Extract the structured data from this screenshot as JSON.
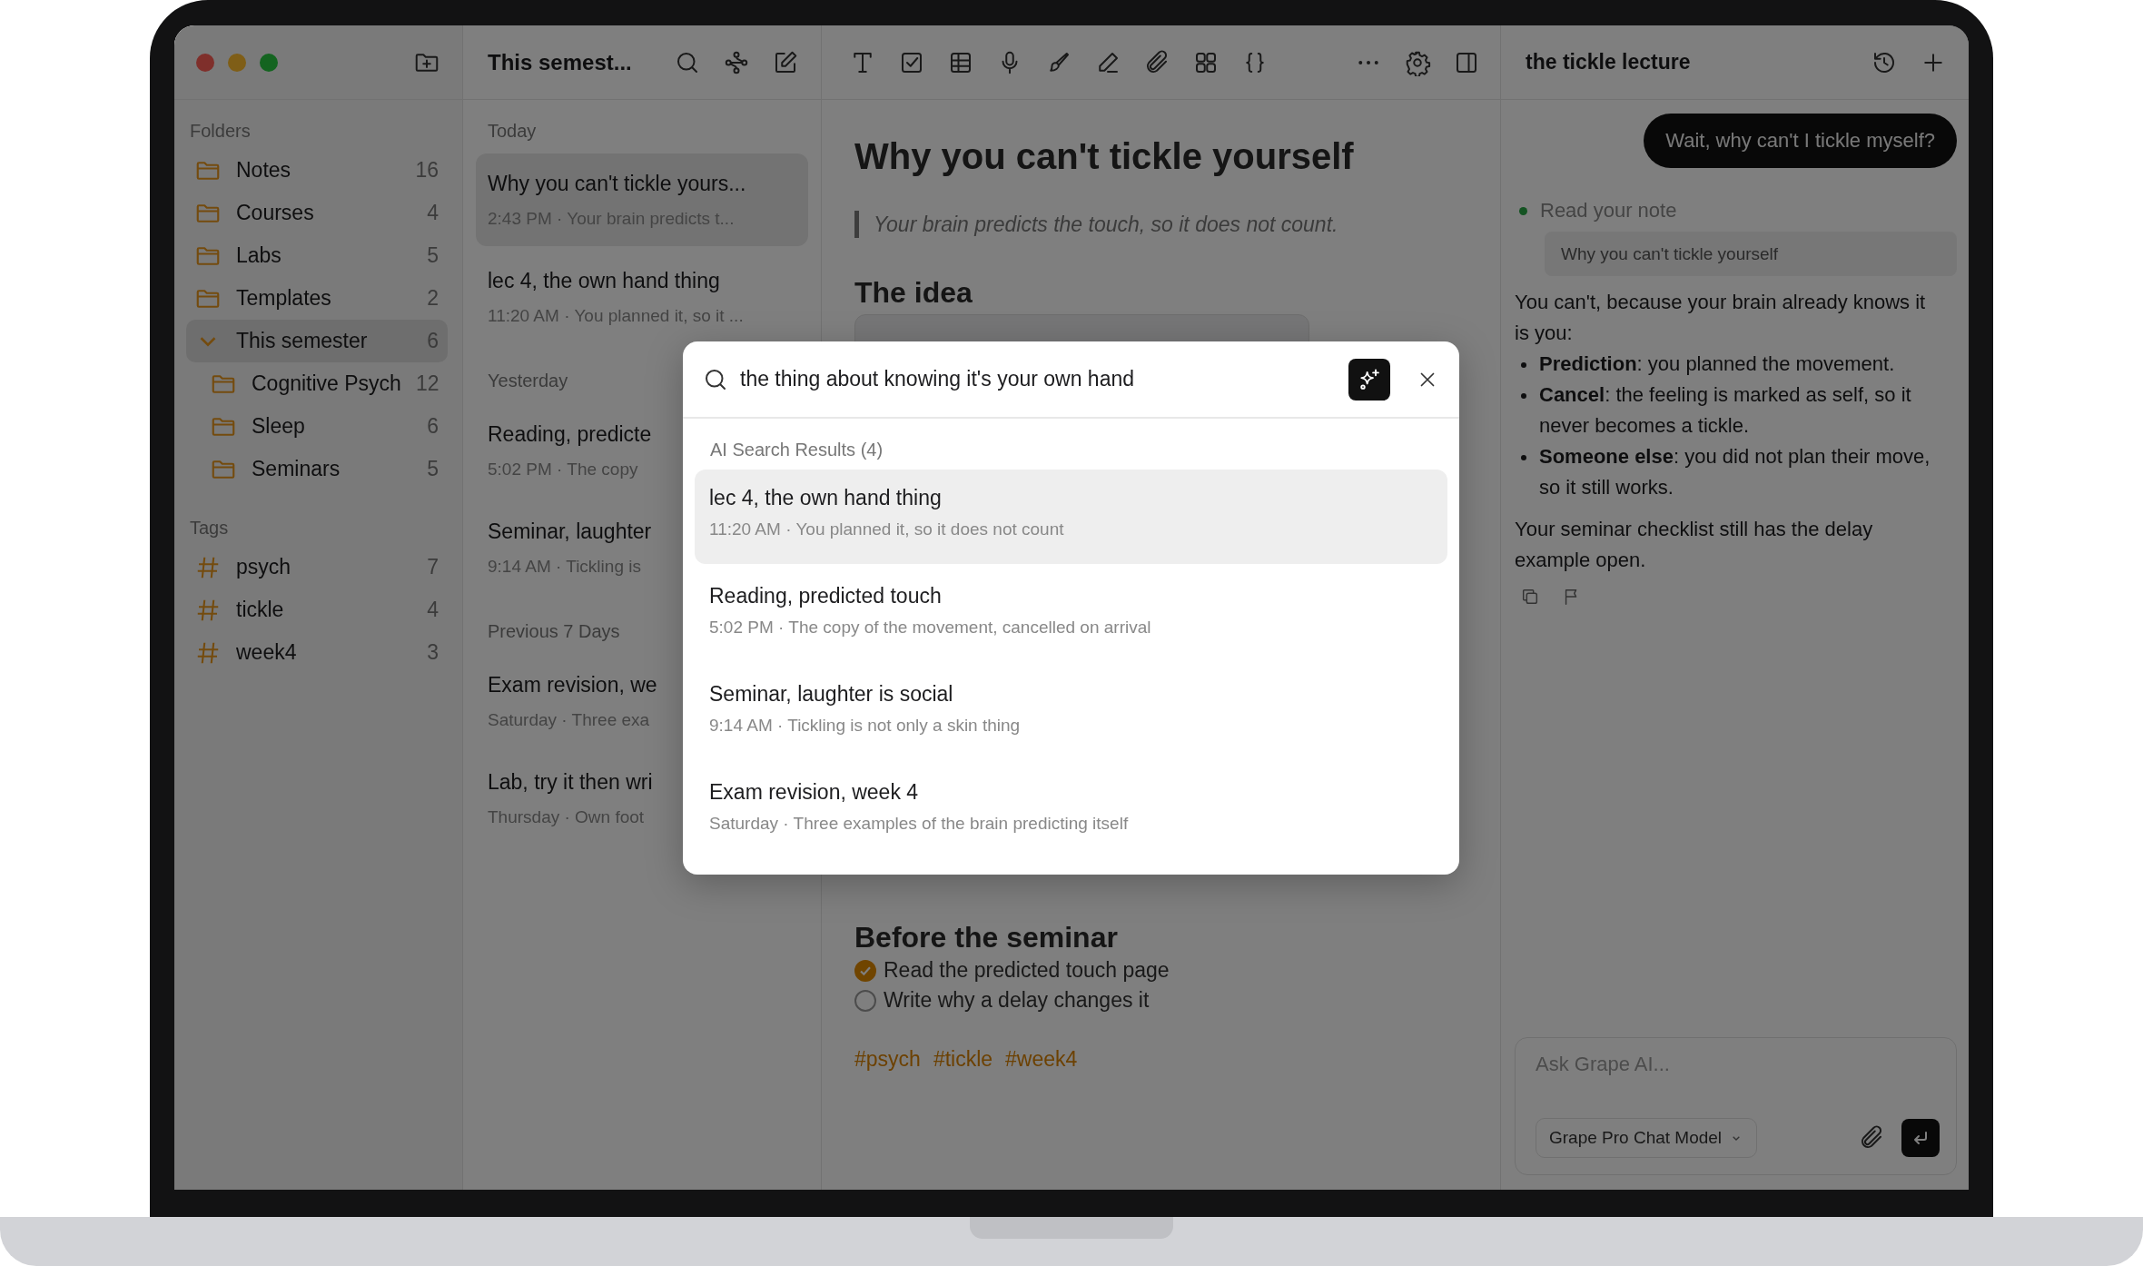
{
  "sidebar": {
    "sections": [
      {
        "label": "Folders",
        "kind": "folder",
        "items": [
          {
            "name": "Notes",
            "count": "16",
            "selected": false
          },
          {
            "name": "Courses",
            "count": "4",
            "selected": false
          },
          {
            "name": "Labs",
            "count": "5",
            "selected": false
          },
          {
            "name": "Templates",
            "count": "2",
            "selected": false
          },
          {
            "name": "This semester",
            "count": "6",
            "selected": true,
            "expanded": true,
            "children": [
              {
                "name": "Cognitive Psych",
                "count": "12",
                "selected": false
              },
              {
                "name": "Sleep",
                "count": "6",
                "selected": false
              },
              {
                "name": "Seminars",
                "count": "5",
                "selected": false
              }
            ]
          }
        ]
      },
      {
        "label": "Tags",
        "kind": "tag",
        "items": [
          {
            "name": "psych",
            "count": "7",
            "selected": false
          },
          {
            "name": "tickle",
            "count": "4",
            "selected": false
          },
          {
            "name": "week4",
            "count": "3",
            "selected": false
          }
        ]
      }
    ]
  },
  "notes_list": {
    "title": "This semest...",
    "groups": [
      {
        "label": "Today",
        "notes": [
          {
            "title": "Why you can't tickle yours...",
            "meta": "2:43 PM · Your brain predicts t...",
            "selected": true
          },
          {
            "title": "lec 4, the own hand thing",
            "meta": "11:20 AM · You planned it, so it ...",
            "selected": false
          }
        ]
      },
      {
        "label": "Yesterday",
        "notes": [
          {
            "title": "Reading, predicte",
            "meta": "5:02 PM · The copy",
            "selected": false
          },
          {
            "title": "Seminar, laughter",
            "meta": "9:14 AM · Tickling is",
            "selected": false
          }
        ]
      },
      {
        "label": "Previous 7 Days",
        "notes": [
          {
            "title": "Exam revision, we",
            "meta": "Saturday · Three exa",
            "selected": false
          },
          {
            "title": "Lab, try it then wri",
            "meta": "Thursday · Own foot",
            "selected": false
          }
        ]
      }
    ]
  },
  "editor": {
    "title": "Why you can't tickle yourself",
    "quote": "Your brain predicts the touch, so it does not count.",
    "heading": "The idea",
    "section_heading": "Before the seminar",
    "checklist": [
      {
        "text": "Read the predicted touch page",
        "checked": true
      },
      {
        "text": "Write why a delay changes it",
        "checked": false
      }
    ],
    "tags": [
      "#psych",
      "#tickle",
      "#week4"
    ]
  },
  "assistant": {
    "title": "the tickle lecture",
    "user_message": "Wait, why can't I tickle myself?",
    "tool_step": {
      "label": "Read your note",
      "note": "Why you can't tickle yourself"
    },
    "answer_intro": "You can't, because your brain already knows it is you:",
    "bullets": [
      "**Prediction**: you planned the movement.",
      "**Cancel**: the feeling is marked as self, so it never becomes a tickle.",
      "**Someone else**: you did not plan their move, so it still works."
    ],
    "answer_outro": "Your seminar checklist still has the delay example open.",
    "composer": {
      "placeholder": "Ask Grape AI...",
      "model": "Grape Pro Chat Model"
    }
  },
  "search_modal": {
    "query": "the thing about knowing it's your own hand",
    "results_label": "AI Search Results (4)",
    "results": [
      {
        "title": "lec 4, the own hand thing",
        "meta": "11:20 AM · You planned it, so it does not count",
        "selected": true
      },
      {
        "title": "Reading, predicted touch",
        "meta": "5:02 PM · The copy of the movement, cancelled on arrival",
        "selected": false
      },
      {
        "title": "Seminar, laughter is social",
        "meta": "9:14 AM · Tickling is not only a skin thing",
        "selected": false
      },
      {
        "title": "Exam revision, week 4",
        "meta": "Saturday · Three examples of the brain predicting itself",
        "selected": false
      }
    ]
  }
}
